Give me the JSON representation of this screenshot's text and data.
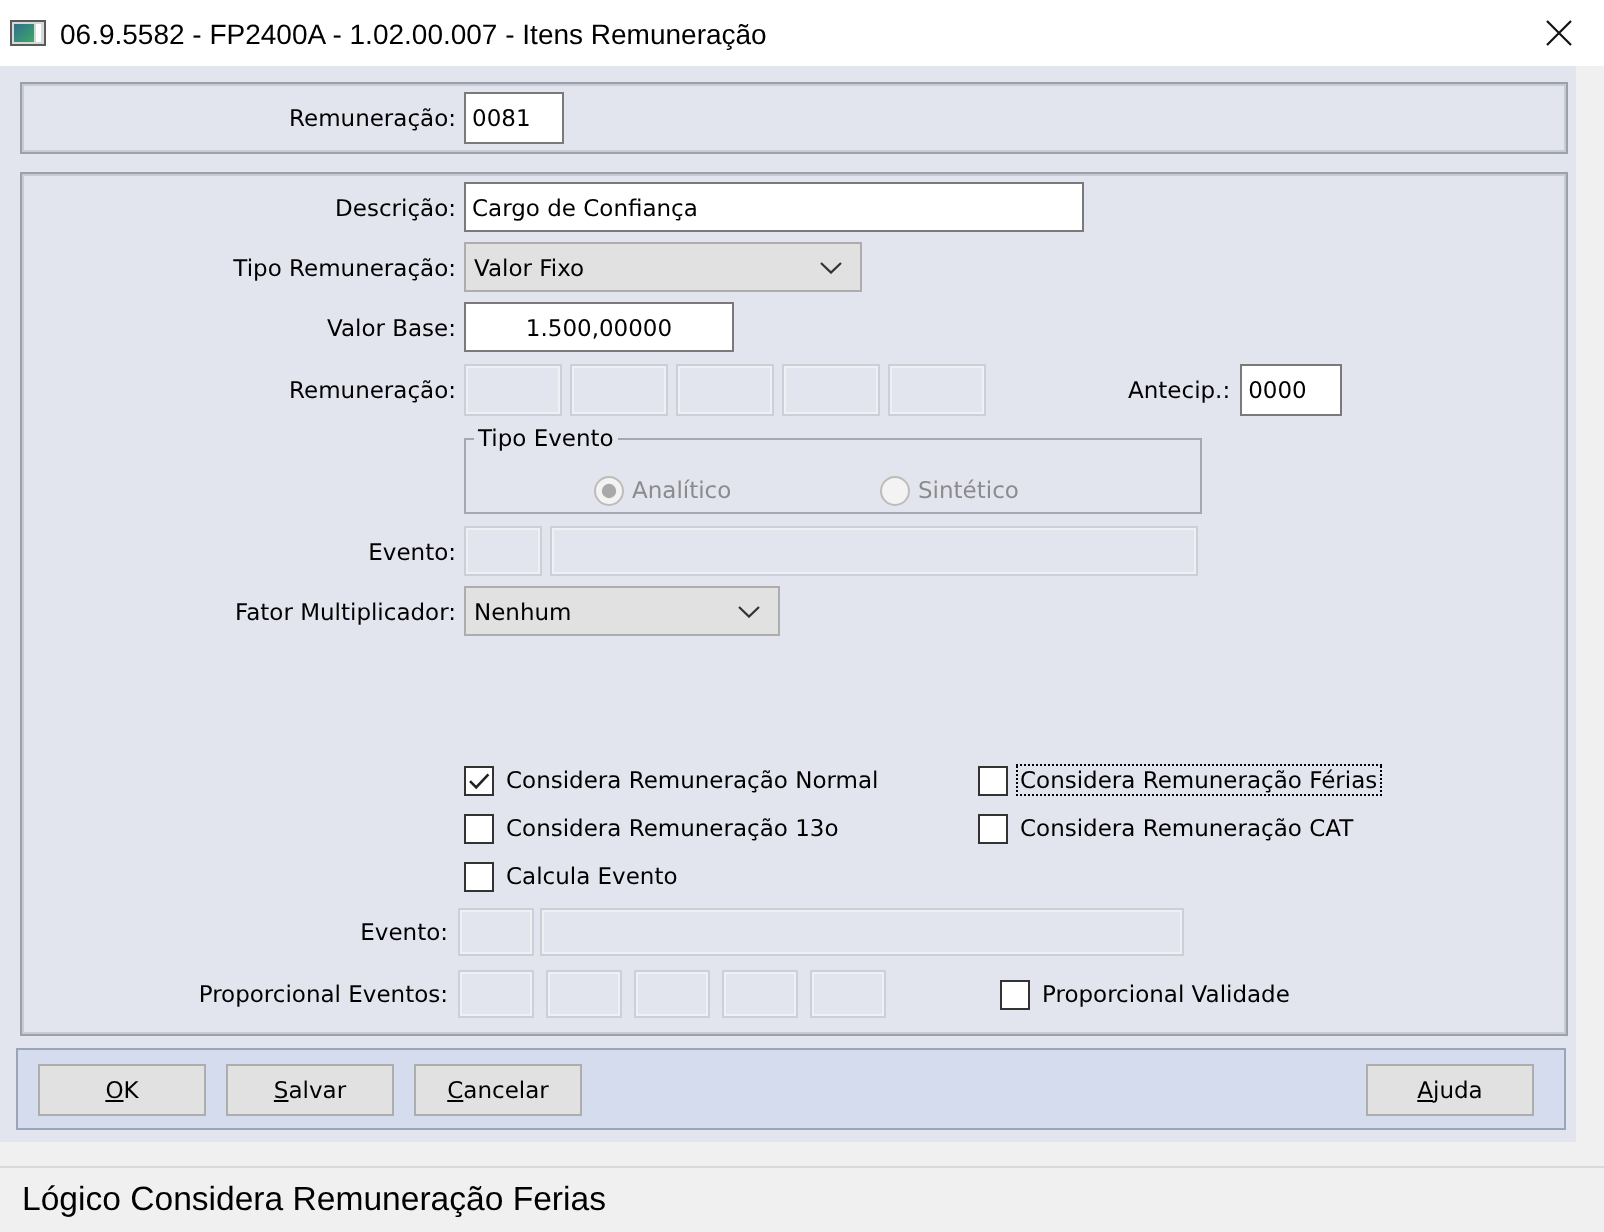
{
  "window": {
    "title": "06.9.5582 - FP2400A - 1.02.00.007 - Itens Remuneração"
  },
  "header": {
    "label": "Remuneração:",
    "value": "0081"
  },
  "form": {
    "descricao": {
      "label": "Descrição:",
      "value": "Cargo de Confiança"
    },
    "tipo_remuneracao": {
      "label": "Tipo Remuneração:",
      "value": "Valor Fixo"
    },
    "valor_base": {
      "label": "Valor Base:",
      "value": "1.500,00000"
    },
    "remuneracao": {
      "label": "Remuneração:",
      "fields": [
        {
          "disabled": true
        },
        {
          "disabled": true
        },
        {
          "disabled": true
        },
        {
          "disabled": true
        },
        {
          "disabled": true
        }
      ]
    },
    "antecip": {
      "label": "Antecip.:",
      "value": "0000"
    },
    "tipo_evento": {
      "title": "Tipo Evento",
      "options": [
        {
          "label": "Analítico",
          "selected": true,
          "disabled": true
        },
        {
          "label": "Sintético",
          "selected": false,
          "disabled": true
        }
      ]
    },
    "evento": {
      "label": "Evento:",
      "fields": [
        {
          "disabled": true
        },
        {
          "disabled": true
        }
      ]
    },
    "fator_multiplicador": {
      "label": "Fator Multiplicador:",
      "value": "Nenhum"
    },
    "checkboxes": [
      {
        "label": "Considera Remuneração Normal",
        "checked": true,
        "focused": false
      },
      {
        "label": "Considera Remuneração Férias",
        "checked": false,
        "focused": true
      },
      {
        "label": "Considera Remuneração 13o",
        "checked": false,
        "focused": false
      },
      {
        "label": "Considera Remuneração CAT",
        "checked": false,
        "focused": false
      },
      {
        "label": "Calcula Evento",
        "checked": false,
        "focused": false
      }
    ],
    "evento_2": {
      "label": "Evento:",
      "fields": [
        {
          "disabled": true
        },
        {
          "disabled": true
        }
      ]
    },
    "proporcional_eventos": {
      "label": "Proporcional Eventos:",
      "fields": [
        {
          "disabled": true
        },
        {
          "disabled": true
        },
        {
          "disabled": true
        },
        {
          "disabled": true
        },
        {
          "disabled": true
        }
      ]
    },
    "proporcional_validade": {
      "label": "Proporcional Validade",
      "checked": false
    }
  },
  "buttons": [
    {
      "label": "OK",
      "underline_first": true
    },
    {
      "label": "Salvar",
      "underline_first": true
    },
    {
      "label": "Cancelar",
      "underline_first": true
    }
  ],
  "help_button": {
    "label": "Ajuda",
    "underline_first": true
  },
  "status_bar": {
    "text": "Lógico Considera Remuneração Ferias"
  }
}
